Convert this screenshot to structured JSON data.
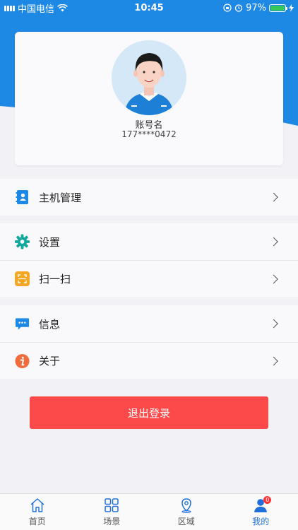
{
  "status_bar": {
    "carrier": "中国电信",
    "time": "10:45",
    "battery": "97%",
    "battery_level": 0.97
  },
  "profile": {
    "account_name": "账号名",
    "phone": "177****0472"
  },
  "menu": {
    "group1": [
      {
        "label": "主机管理",
        "icon": "contacts-book-icon",
        "color": "#1e88e5"
      }
    ],
    "group2": [
      {
        "label": "设置",
        "icon": "gear-icon",
        "color": "#13a89e"
      },
      {
        "label": "扫一扫",
        "icon": "scan-icon",
        "color": "#f5a623"
      }
    ],
    "group3": [
      {
        "label": "信息",
        "icon": "message-icon",
        "color": "#1e88e5"
      },
      {
        "label": "关于",
        "icon": "info-icon",
        "color": "#f26b3a"
      }
    ]
  },
  "logout": {
    "label": "退出登录",
    "color": "#fc4a4a"
  },
  "tabbar": {
    "tabs": [
      {
        "label": "首页",
        "icon": "home-icon"
      },
      {
        "label": "场景",
        "icon": "grid-icon"
      },
      {
        "label": "区域",
        "icon": "location-icon"
      },
      {
        "label": "我的",
        "icon": "user-icon",
        "active": true,
        "badge": "0"
      }
    ]
  },
  "colors": {
    "primary": "#1e88e5",
    "active_tab": "#1e6fd9"
  }
}
